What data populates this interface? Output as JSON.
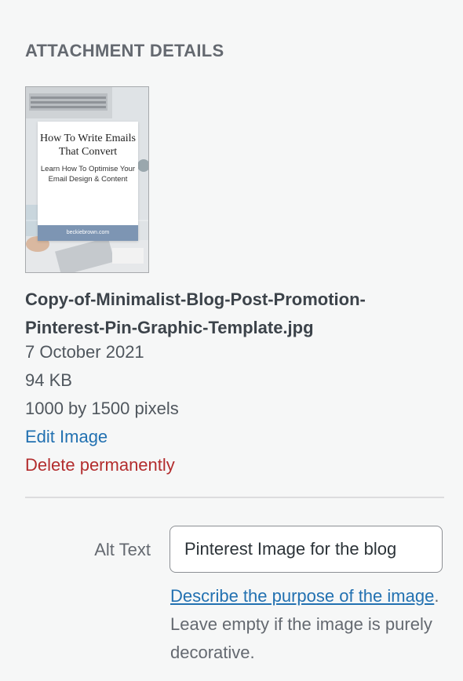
{
  "section": {
    "title": "ATTACHMENT DETAILS"
  },
  "thumbnail": {
    "title": "How To Write Emails That Convert",
    "subtitle": "Learn How To Optimise Your Email Design & Content",
    "footer": "beckiebrown.com",
    "accent": "#7d95b3"
  },
  "file": {
    "name": "Copy-of-Minimalist-Blog-Post-Promotion-Pinterest-Pin-Graphic-Template.jpg",
    "date": "7 October 2021",
    "size": "94 KB",
    "dimensions": "1000 by 1500 pixels"
  },
  "actions": {
    "edit_label": "Edit Image",
    "delete_label": "Delete permanently"
  },
  "alt_text": {
    "label": "Alt Text",
    "value": "Pinterest Image for the blog",
    "help_link": "Describe the purpose of the image",
    "help_rest": ". Leave empty if the image is purely decorative."
  },
  "colors": {
    "link": "#2271b1",
    "danger": "#b32d2e",
    "background": "#f6f7f7"
  }
}
